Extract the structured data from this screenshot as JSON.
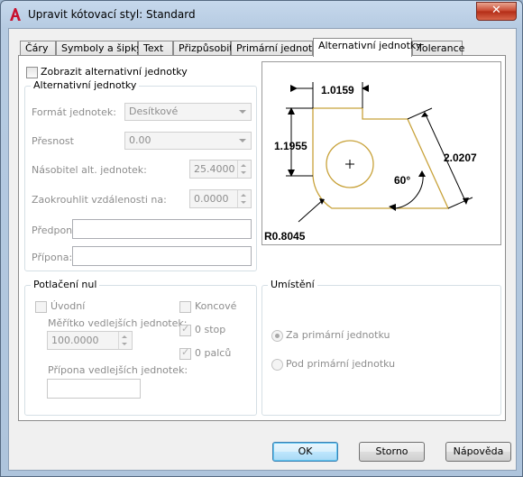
{
  "window": {
    "title": "Upravit kótovací styl: Standard",
    "close_glyph": "✕"
  },
  "tabs": [
    {
      "label": "Čáry"
    },
    {
      "label": "Symboly a šipky"
    },
    {
      "label": "Text"
    },
    {
      "label": "Přizpůsobit"
    },
    {
      "label": "Primární jednotky"
    },
    {
      "label": "Alternativní jednotky",
      "active": true
    },
    {
      "label": "Tolerance"
    }
  ],
  "alt": {
    "show_label": "Zobrazit alternativní jednotky",
    "group_title": "Alternativní jednotky",
    "format_label": "Formát jednotek:",
    "format_value": "Desítkové",
    "precision_label": "Přesnost",
    "precision_value": "0.00",
    "multiplier_label": "Násobitel alt. jednotek:",
    "multiplier_value": "25.4000",
    "round_label": "Zaokrouhlit vzdálenosti na:",
    "round_value": "0.0000",
    "prefix_label": "Předpona:",
    "suffix_label": "Přípona:"
  },
  "zero": {
    "group_title": "Potlačení nul",
    "leading_label": "Úvodní",
    "trailing_label": "Koncové",
    "sub_scale_label": "Měřítko vedlejších jednotek:",
    "sub_scale_value": "100.0000",
    "sub_suffix_label": "Přípona vedlejších jednotek:",
    "feet_label": "0 stop",
    "inches_label": "0 palců"
  },
  "placement": {
    "group_title": "Umístění",
    "after_label": "Za primární jednotku",
    "below_label": "Pod primární jednotku"
  },
  "preview": {
    "dim_top": "1.0159",
    "dim_left": "1.1955",
    "dim_right": "2.0207",
    "dim_angle": "60°",
    "dim_radius": "R0.8045",
    "shape_color": "#c8a23a"
  },
  "buttons": {
    "ok": "OK",
    "cancel": "Storno",
    "help": "Nápověda"
  }
}
